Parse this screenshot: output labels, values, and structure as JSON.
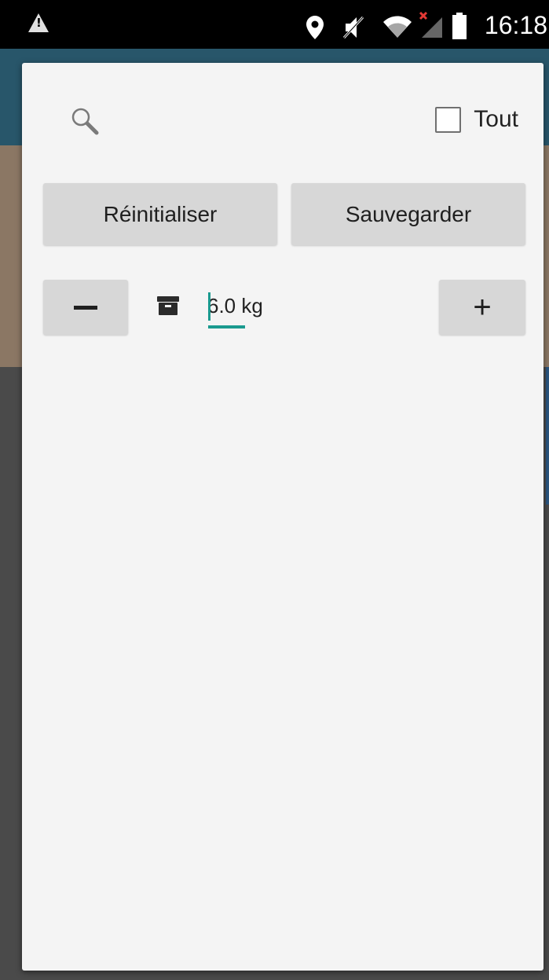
{
  "status_bar": {
    "time": "16:18",
    "icons": [
      "warning-icon",
      "location-icon",
      "mute-icon",
      "wifi-icon",
      "no-signal-icon",
      "battery-icon"
    ]
  },
  "dialog": {
    "select_all_label": "Tout",
    "select_all_checked": false,
    "reset_label": "Réinitialiser",
    "save_label": "Sauvegarder",
    "decrement_label": "−",
    "increment_label": "+",
    "weight": {
      "value": "6.0 kg"
    }
  },
  "colors": {
    "accent": "#1a9a8f",
    "dialog_bg": "#f4f4f4",
    "button_bg": "#d7d7d7"
  }
}
